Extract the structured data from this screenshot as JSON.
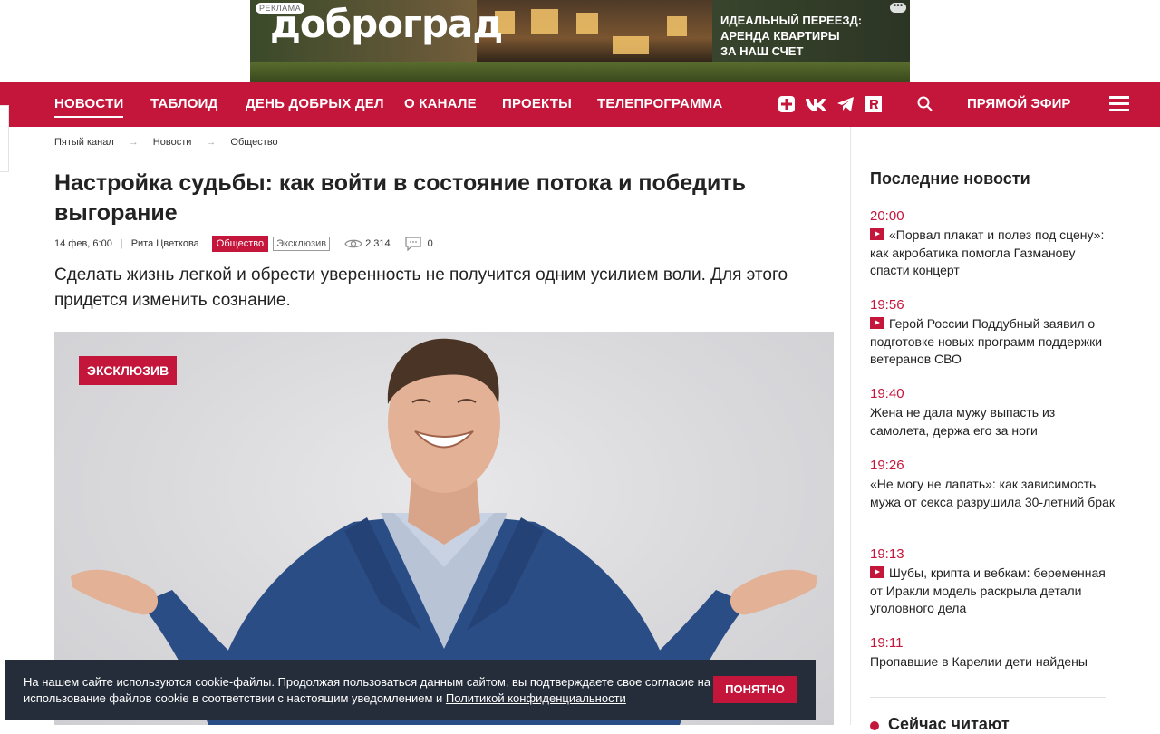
{
  "ad": {
    "tag": "РЕКЛАМА",
    "brand": "доброград",
    "promo_line1": "ИДЕАЛЬНЫЙ ПЕРЕЕЗД:",
    "promo_line2": "АРЕНДА КВАРТИРЫ",
    "promo_line3": "ЗА НАШ СЧЕТ",
    "more": "•••"
  },
  "nav": {
    "items": [
      "НОВОСТИ",
      "ТАБЛОИД",
      "ДЕНЬ ДОБРЫХ ДЕЛ",
      "О КАНАЛЕ",
      "ПРОЕКТЫ",
      "ТЕЛЕПРОГРАММА"
    ],
    "live": "ПРЯМОЙ ЭФИР",
    "social_icons": [
      "plus-icon",
      "vk-icon",
      "telegram-icon",
      "rutube-icon",
      "search-icon",
      "menu-icon"
    ]
  },
  "breadcrumb": [
    "Пятый канал",
    "Новости",
    "Общество"
  ],
  "article": {
    "title": "Настройка судьбы: как войти в состояние потока и победить выгорание",
    "date": "14 фев, 6:00",
    "author": "Рита Цветкова",
    "tag_primary": "Общество",
    "tag_secondary": "Эксклюзив",
    "views": "2 314",
    "comments": "0",
    "lead": "Сделать жизнь легкой и обрести уверенность не получится одним усилием воли. Для этого придется изменить сознание.",
    "photo_badge": "ЭКСКЛЮЗИВ"
  },
  "sidebar": {
    "title": "Последние новости",
    "items": [
      {
        "time": "20:00",
        "video": true,
        "text": "«Порвал плакат и полез под сцену»: как акробатика помогла Газманову спасти концерт"
      },
      {
        "time": "19:56",
        "video": true,
        "text": "Герой России Поддубный заявил о подготовке новых программ поддержки ветеранов СВО"
      },
      {
        "time": "19:40",
        "video": false,
        "text": "Жена не дала мужу выпасть из самолета, держа его за ноги"
      },
      {
        "time": "19:26",
        "video": false,
        "text": "«Не могу не лапать»: как зависимость мужа от секса разрушила 30-летний брак"
      },
      {
        "time": "19:13",
        "video": true,
        "text": "Шубы, крипта и вебкам: беременная от Иракли модель раскрыла детали уголовного дела"
      },
      {
        "time": "19:11",
        "video": false,
        "text": "Пропавшие в Карелии дети найдены"
      }
    ],
    "next_title": "Сейчас читают"
  },
  "cookie": {
    "text": "На нашем сайте используются cookie-файлы. Продолжая пользоваться данным сайтом, вы подтверждаете свое согласие на использование файлов cookie в соответствии с настоящим уведомлением и ",
    "link": "Политикой конфиденциальности",
    "button": "ПОНЯТНО"
  },
  "colors": {
    "brand_red": "#c4153b",
    "cookie_bg": "#262d3a"
  }
}
